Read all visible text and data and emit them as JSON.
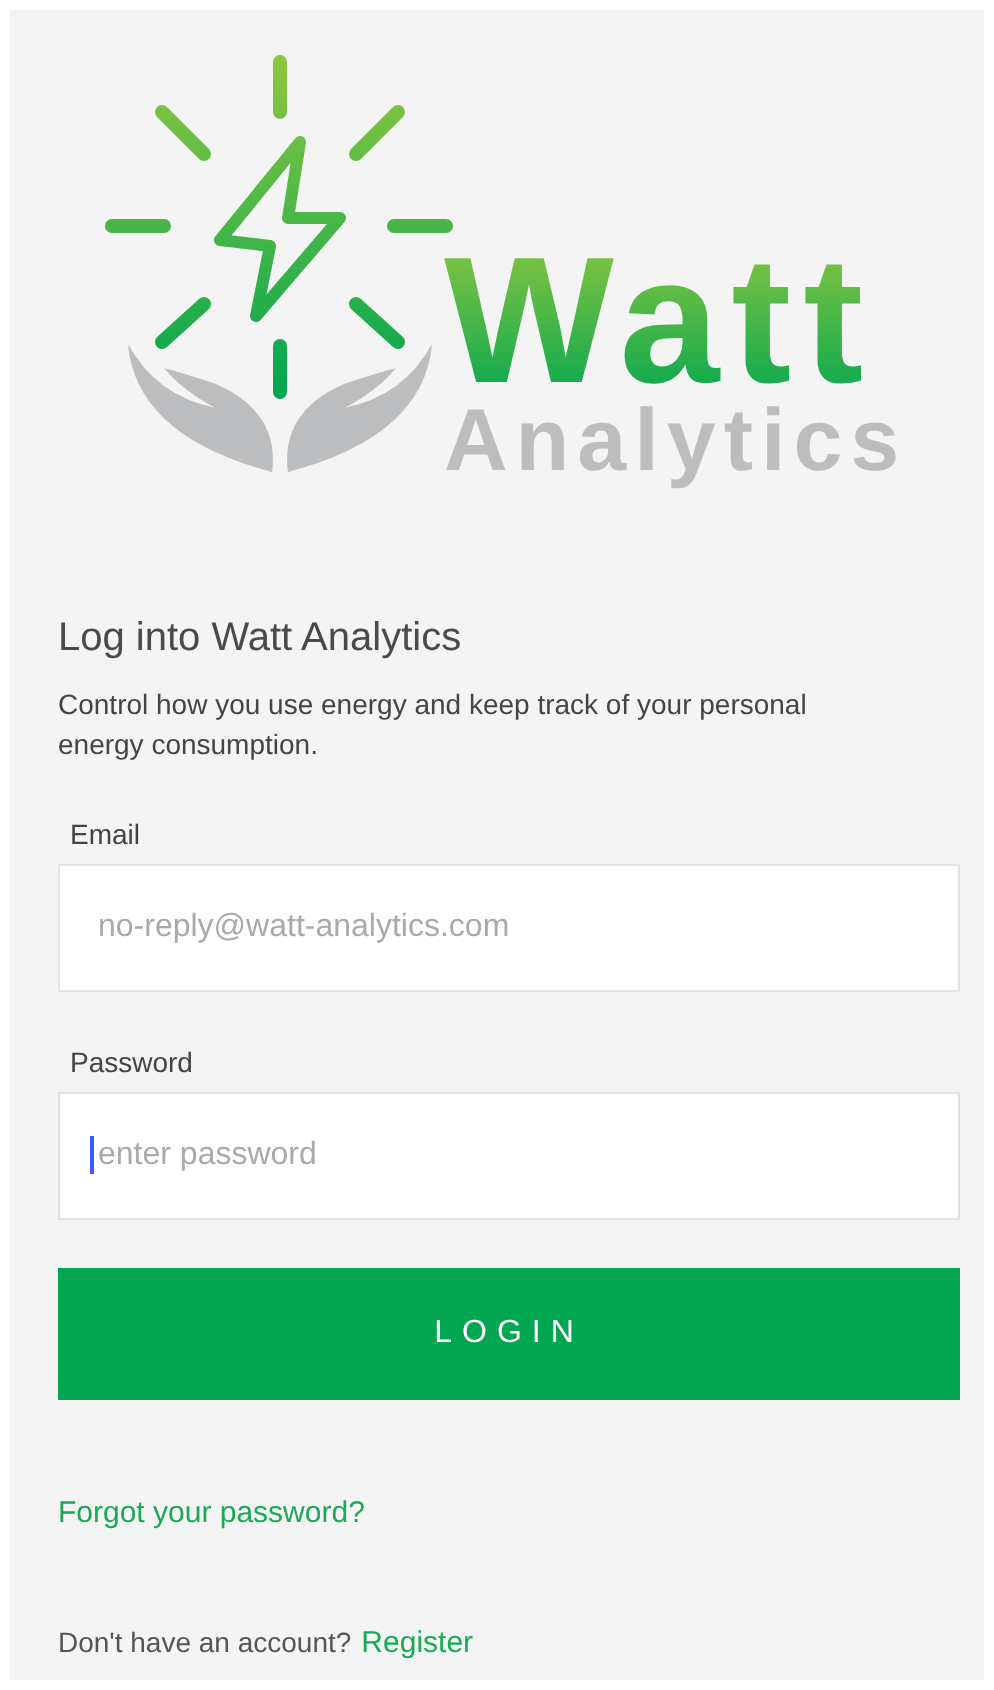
{
  "logo": {
    "word_1": "Watt",
    "word_2": "Analytics"
  },
  "heading": "Log into Watt Analytics",
  "description": "Control how you use energy and keep track of your personal energy consumption.",
  "fields": [
    {
      "label": "Email",
      "placeholder": "no-reply@watt-analytics.com",
      "focused": false
    },
    {
      "label": "Password",
      "placeholder": "enter password",
      "focused": true
    }
  ],
  "login_button": "LOGIN",
  "forgot_link": "Forgot your password?",
  "register": {
    "prompt": "Don't have an account?",
    "link": "Register"
  }
}
